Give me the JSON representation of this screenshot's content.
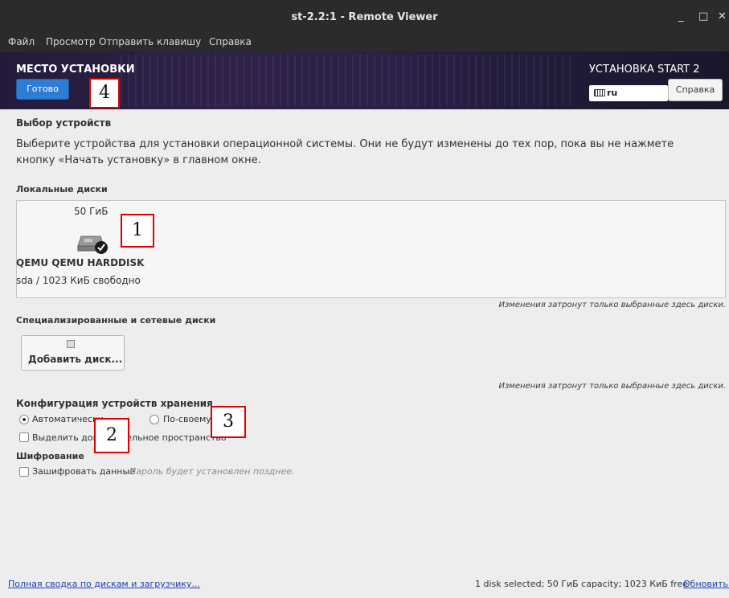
{
  "window": {
    "title": "st-2.2:1 - Remote Viewer",
    "minimize": "_",
    "maximize": "□",
    "close": "✕"
  },
  "menu": [
    "Файл",
    "Просмотр",
    "Отправить клавишу",
    "Справка"
  ],
  "header": {
    "spoke_title": "МЕСТО УСТАНОВКИ",
    "done_label": "Готово",
    "product_title": "УСТАНОВКА START 2",
    "keyboard_layout": "ru",
    "help_label": "Справка"
  },
  "content": {
    "section_title": "Выбор устройств",
    "description": "Выберите устройства для установки операционной системы. Они не будут изменены до тех пор, пока вы не нажмете кнопку «Начать установку» в главном окне.",
    "local_disks_label": "Локальные диски",
    "disk": {
      "size": "50 ГиБ",
      "name": "QEMU QEMU HARDDISK",
      "free": "sda / 1023 КиБ свободно",
      "selected": true
    },
    "local_note": "Изменения затронут только выбранные здесь диски.",
    "network_disks_label": "Специализированные и сетевые диски",
    "add_disk_label": "Добавить диск...",
    "network_note": "Изменения затронут только выбранные здесь диски.",
    "storage_config_title": "Конфигурация устройств хранения",
    "auto_label": "Автоматически",
    "custom_label": "По-своему",
    "auto_selected": true,
    "reclaim_label": "Выделить дополнительное пространство",
    "encryption_title": "Шифрование",
    "encrypt_label": "Зашифровать данные",
    "encrypt_hint": "Пароль будет установлен позднее."
  },
  "annotations": [
    "4",
    "1",
    "3",
    "2"
  ],
  "footer": {
    "summary_link": "Полная сводка по дискам и загрузчику...",
    "status": "1 disk selected; 50 ГиБ capacity; 1023 КиБ free",
    "refresh_link": "Обновить..."
  }
}
